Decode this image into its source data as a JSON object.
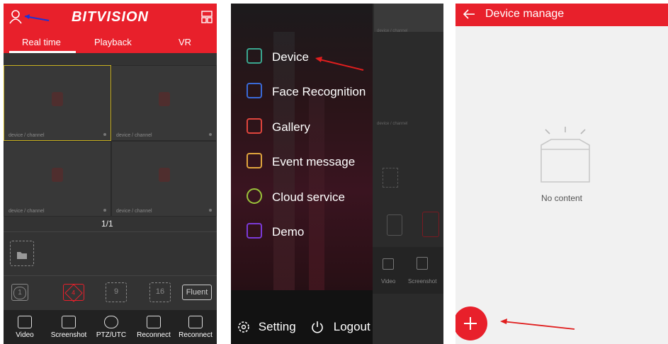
{
  "panel1": {
    "brand": "BITVISION",
    "tabs": [
      "Real time",
      "Playback",
      "VR"
    ],
    "cells": [
      {
        "label": "device / channel"
      },
      {
        "label": "device / channel"
      },
      {
        "label": "device / channel"
      },
      {
        "label": "device / channel"
      }
    ],
    "pager": "1/1",
    "layout_buttons": [
      "1",
      "4",
      "9",
      "16"
    ],
    "quality_button": "Fluent",
    "bottom_nav": [
      "Video",
      "Screenshot",
      "PTZ/UTC",
      "Reconnect",
      "Reconnect"
    ]
  },
  "panel2": {
    "menu": [
      {
        "label": "Device",
        "color": "#3aa68f"
      },
      {
        "label": "Face Recognition",
        "color": "#3a6ad8"
      },
      {
        "label": "Gallery",
        "color": "#e0453d"
      },
      {
        "label": "Event message",
        "color": "#e0a53d"
      },
      {
        "label": "Cloud service",
        "color": "#9bc43a"
      },
      {
        "label": "Demo",
        "color": "#7b3ad8"
      }
    ],
    "setting": "Setting",
    "logout": "Logout",
    "bg_fragments": {
      "cell_label": "device / channel",
      "nav": [
        "Video",
        "Screenshot"
      ]
    }
  },
  "panel3": {
    "title": "Device manage",
    "empty_text": "No content",
    "accent": "#e8202b"
  },
  "colors": {
    "brand_red": "#e8202b",
    "arrow_red": "#e01e1e",
    "arrow_blue": "#1a33d8"
  }
}
